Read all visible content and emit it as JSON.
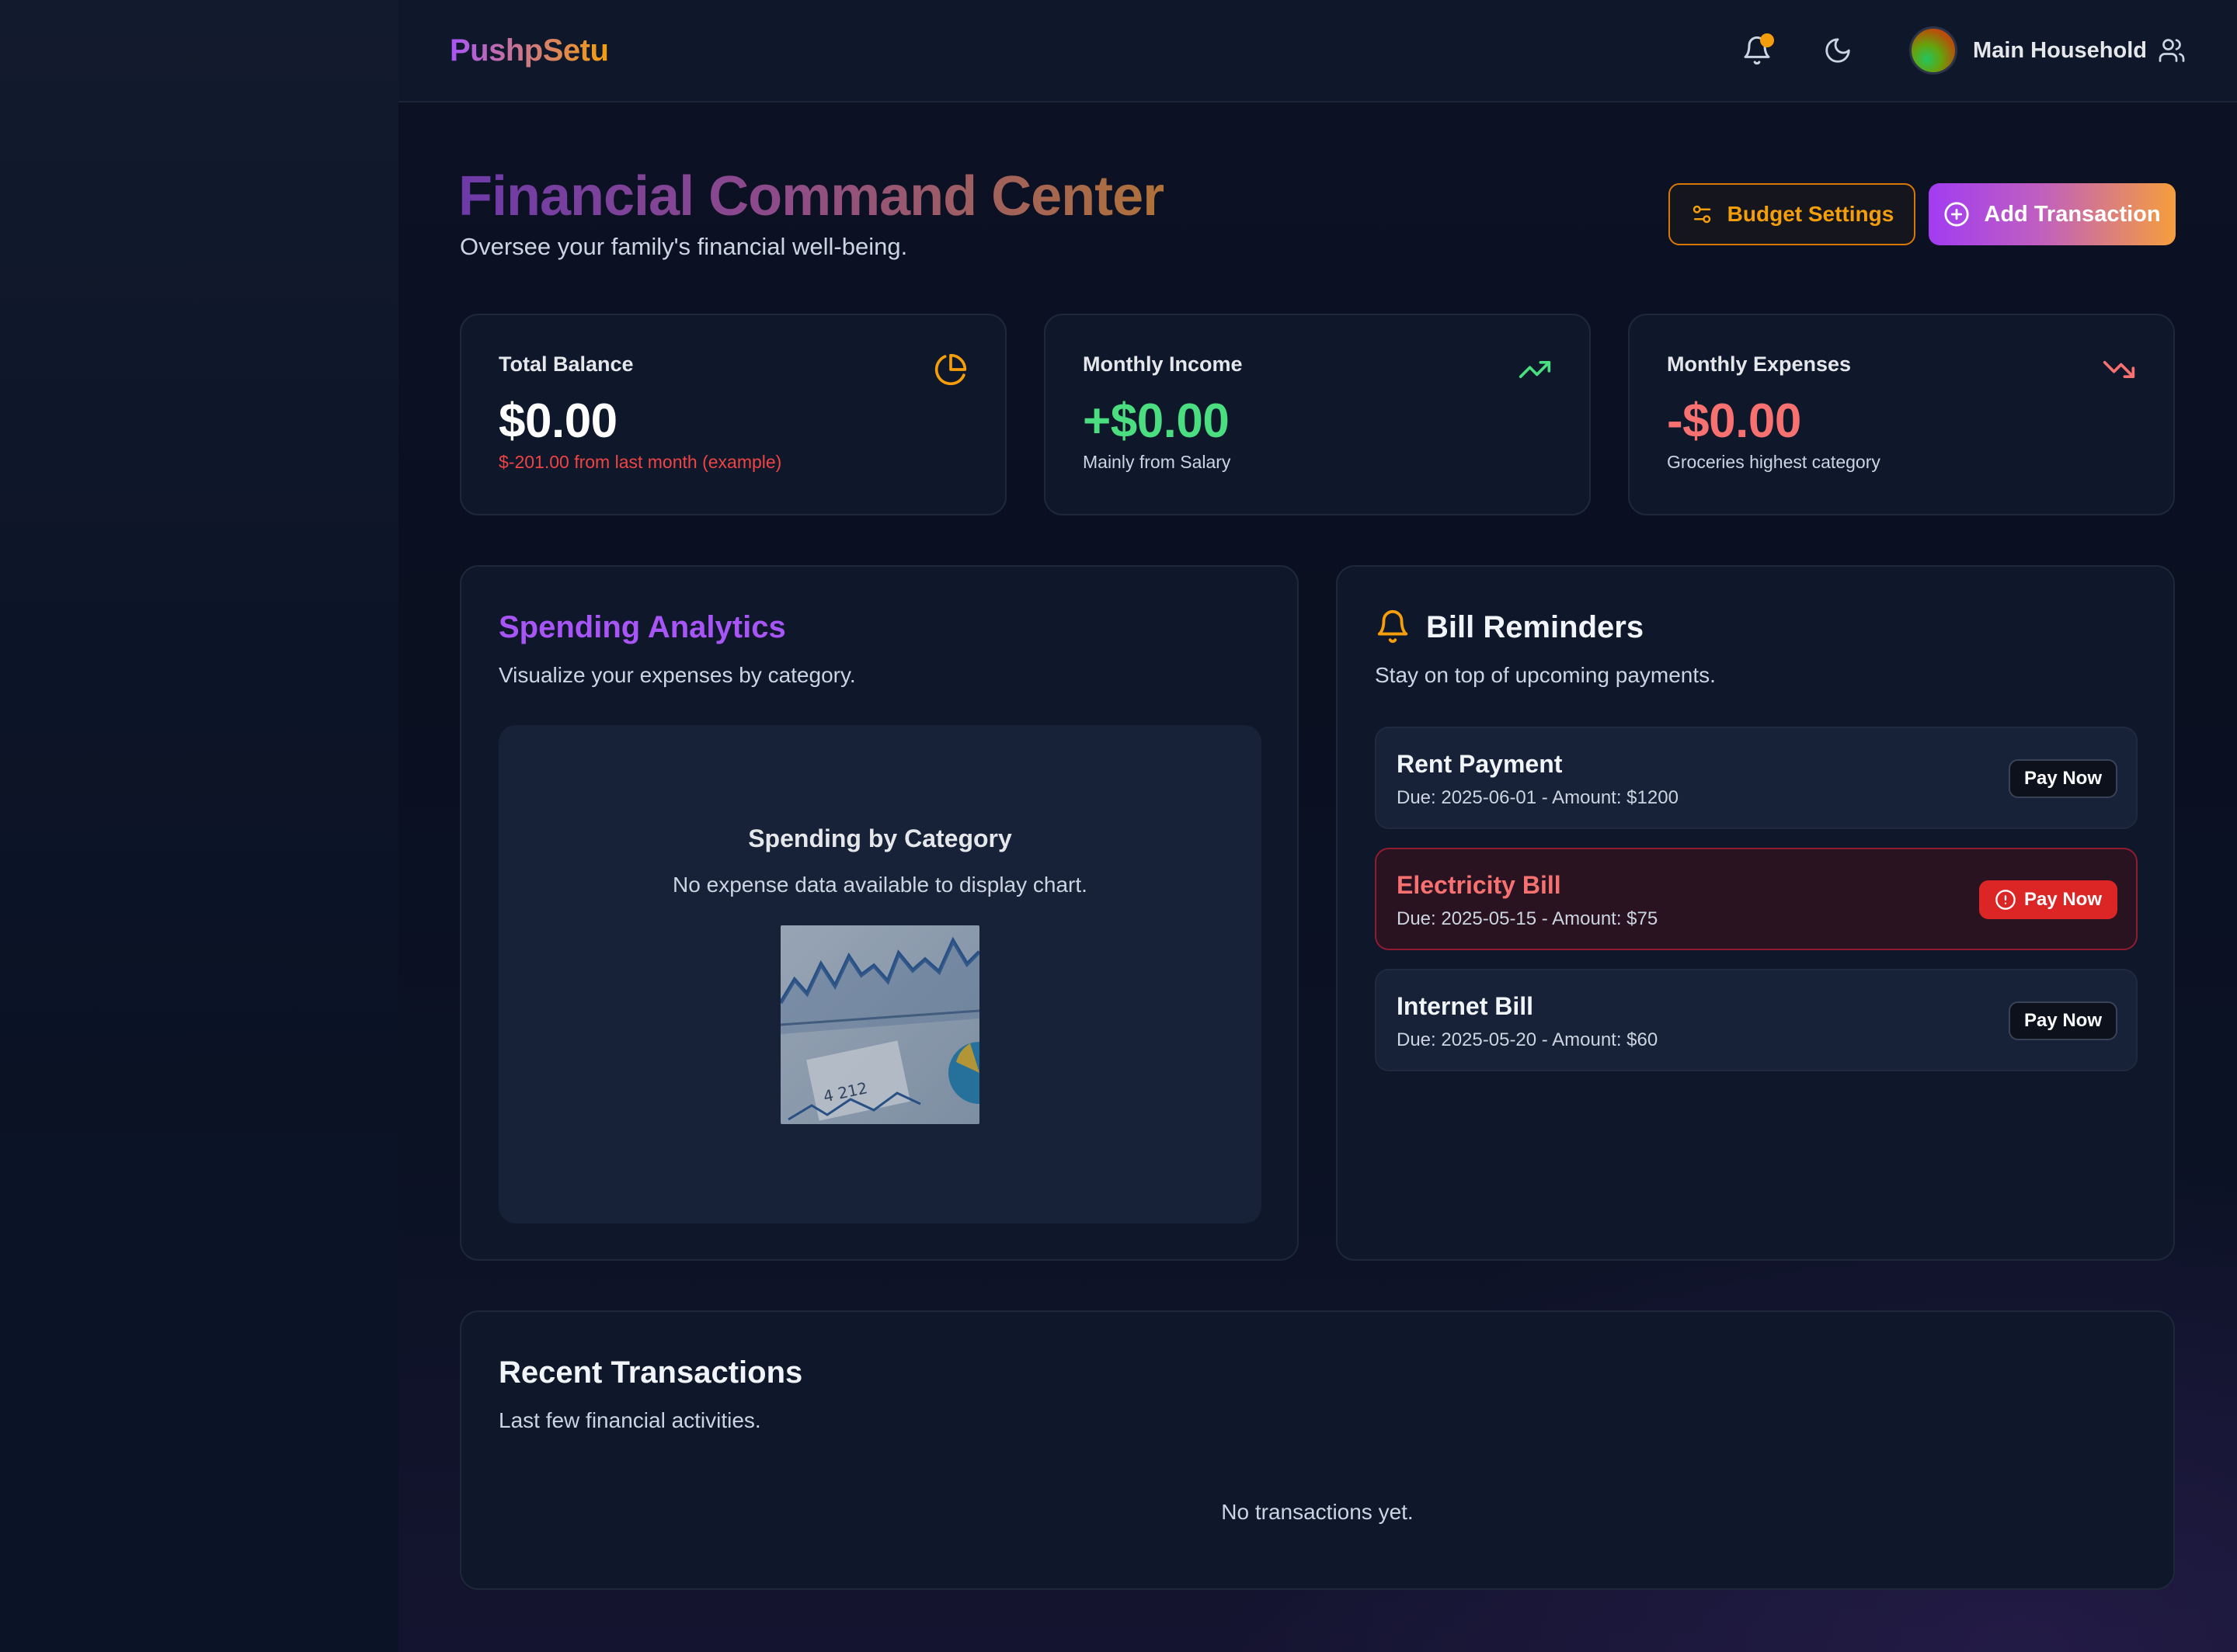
{
  "brand": "PushpSetu",
  "header": {
    "household": "Main Household",
    "colors": {
      "notification_dot": "#f59e0b"
    }
  },
  "page": {
    "title": "Financial Command Center",
    "subtitle": "Oversee your family's financial well-being."
  },
  "actions": {
    "budget_settings": "Budget Settings",
    "add_transaction": "Add Transaction"
  },
  "stats": [
    {
      "label": "Total Balance",
      "value": "$0.00",
      "note": "$-201.00 from last month (example)",
      "icon": "pie-chart-icon",
      "value_color": "#ffffff",
      "note_color": "#ef4444"
    },
    {
      "label": "Monthly Income",
      "value": "+$0.00",
      "note": "Mainly from Salary",
      "icon": "trending-up-icon",
      "value_color": "#4ade80",
      "note_color": "#cbd5e1"
    },
    {
      "label": "Monthly Expenses",
      "value": "-$0.00",
      "note": "Groceries highest category",
      "icon": "trending-down-icon",
      "value_color": "#f87171",
      "note_color": "#cbd5e1"
    }
  ],
  "analytics": {
    "title": "Spending Analytics",
    "subtitle": "Visualize your expenses by category.",
    "chart_title": "Spending by Category",
    "chart_empty": "No expense data available to display chart.",
    "image_text": "4 212"
  },
  "bills": {
    "title": "Bill Reminders",
    "subtitle": "Stay on top of upcoming payments.",
    "items": [
      {
        "name": "Rent Payment",
        "due": "Due: 2025-06-01 - Amount: $1200",
        "action": "Pay Now",
        "overdue": false
      },
      {
        "name": "Electricity Bill",
        "due": "Due: 2025-05-15 - Amount: $75",
        "action": "Pay Now",
        "overdue": true
      },
      {
        "name": "Internet Bill",
        "due": "Due: 2025-05-20 - Amount: $60",
        "action": "Pay Now",
        "overdue": false
      }
    ]
  },
  "transactions": {
    "title": "Recent Transactions",
    "subtitle": "Last few financial activities.",
    "empty": "No transactions yet."
  }
}
